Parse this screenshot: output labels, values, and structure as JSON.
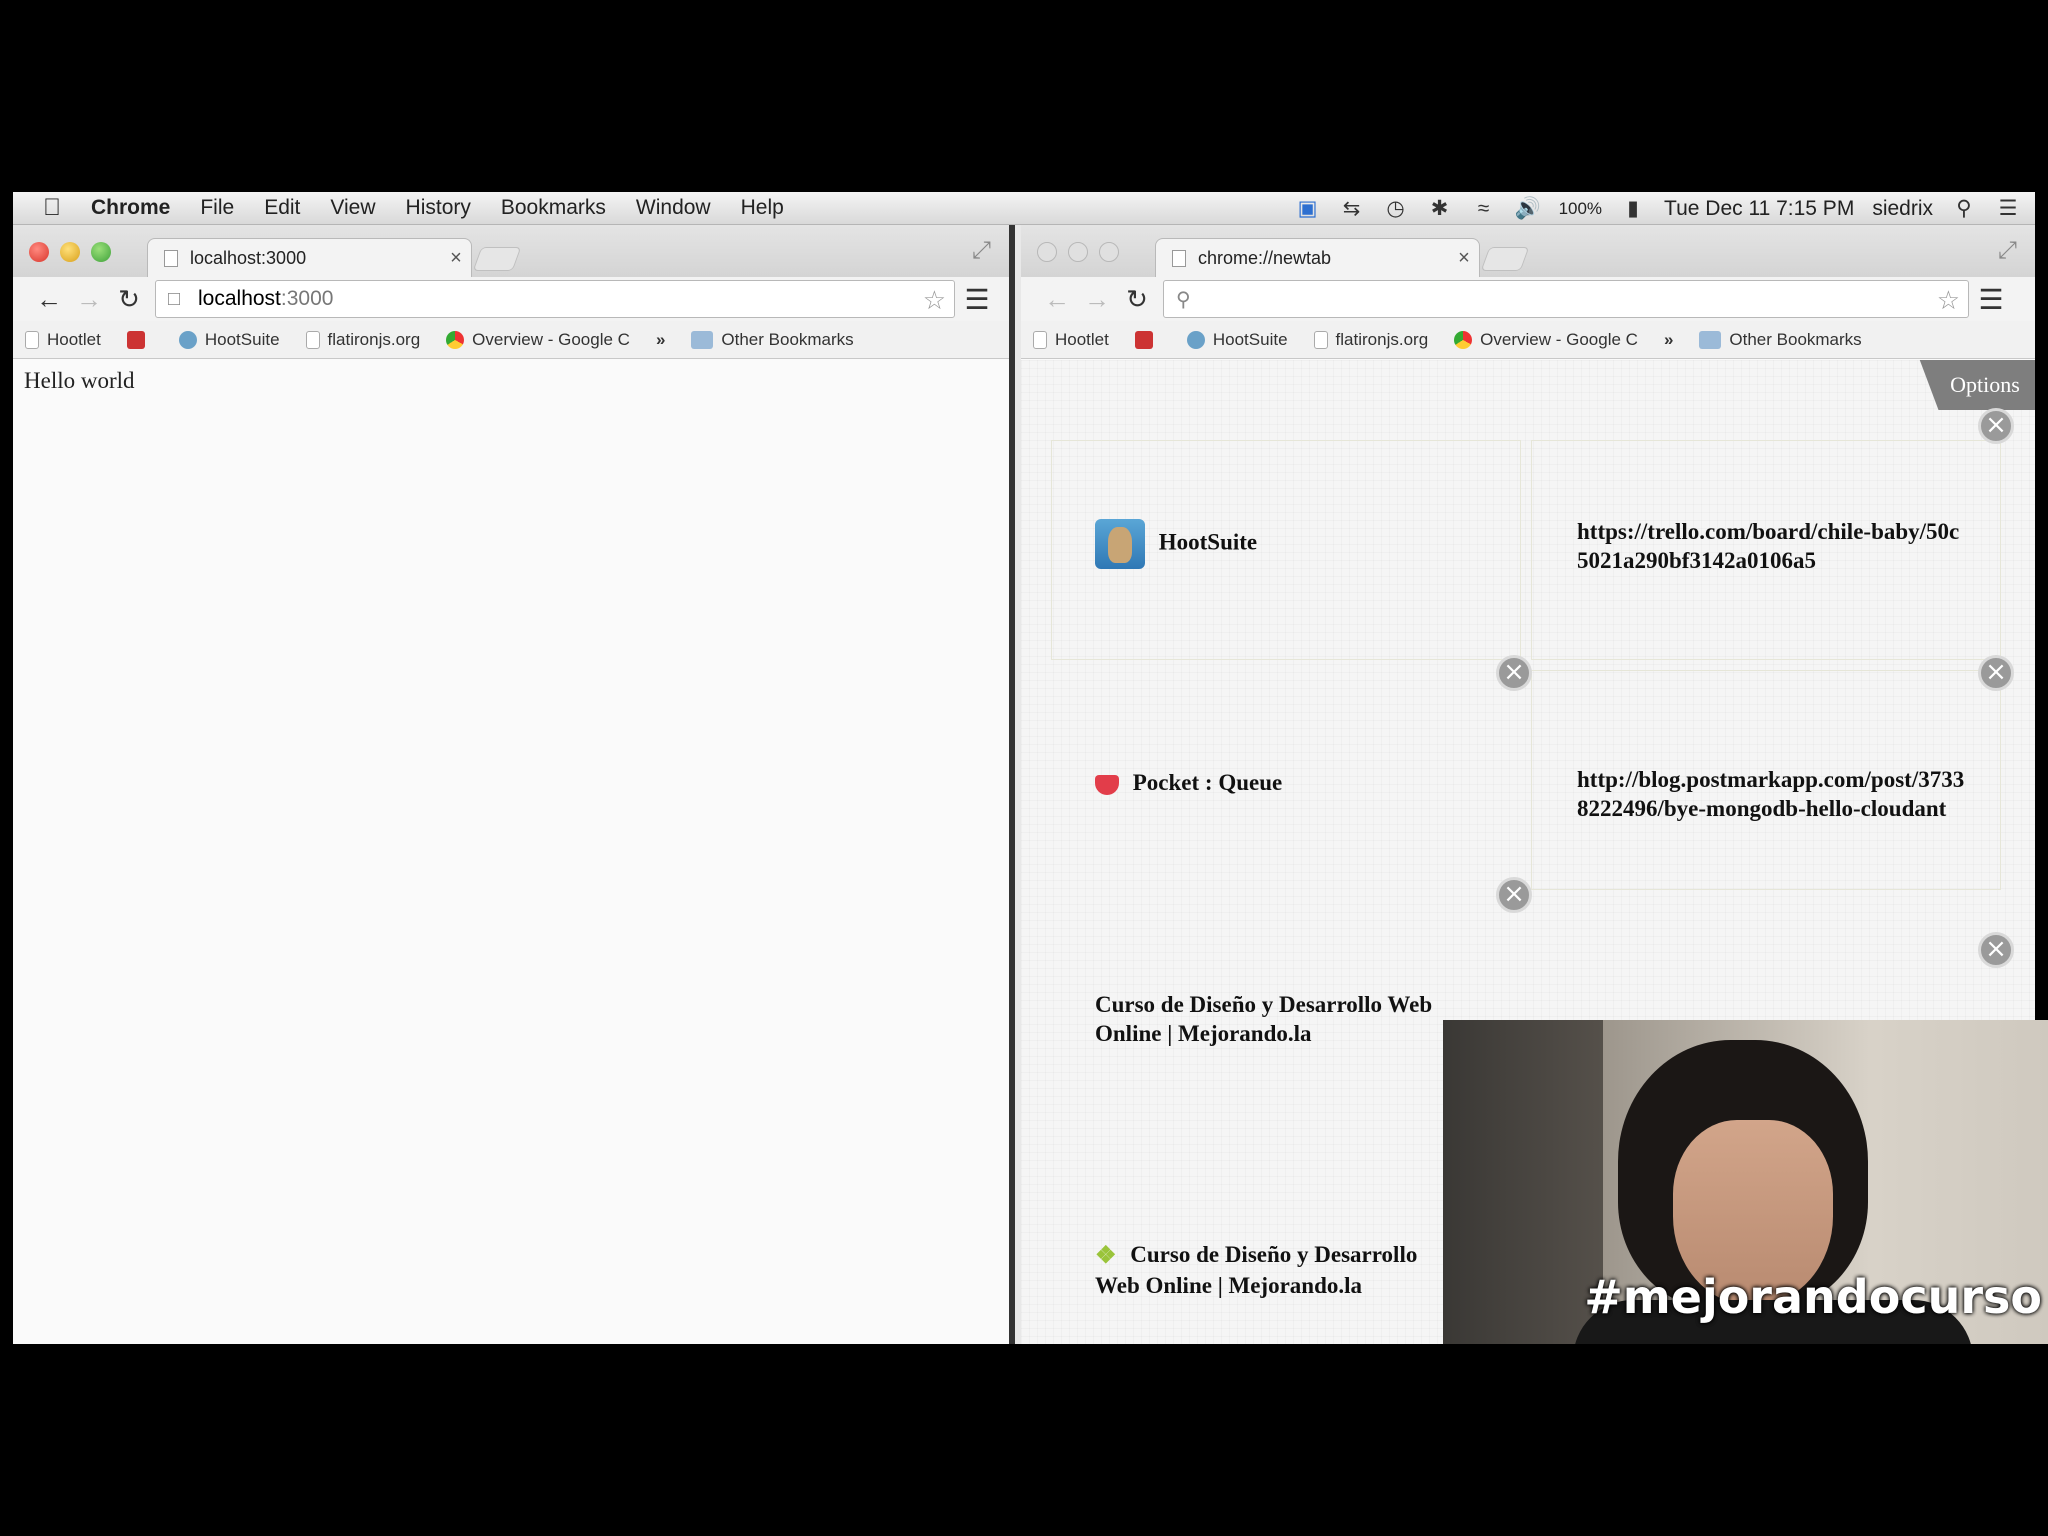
{
  "menubar": {
    "app_name": "Chrome",
    "menus": [
      "File",
      "Edit",
      "View",
      "History",
      "Bookmarks",
      "Window",
      "Help"
    ],
    "battery": "100%",
    "clock": "Tue Dec 11  7:15 PM",
    "user": "siedrix"
  },
  "left_window": {
    "tab_title": "localhost:3000",
    "url_host": "localhost",
    "url_port": ":3000",
    "bookmarks": [
      "Hootlet",
      "HootSuite",
      "flatironjs.org",
      "Overview - Google C"
    ],
    "other_bookmarks": "Other Bookmarks",
    "page_text": "Hello world"
  },
  "right_window": {
    "tab_title": "chrome://newtab",
    "bookmarks": [
      "Hootlet",
      "HootSuite",
      "flatironjs.org",
      "Overview - Google C"
    ],
    "other_bookmarks": "Other Bookmarks",
    "options_label": "Options",
    "tiles": [
      {
        "title": "HootSuite"
      },
      {
        "title": "https://trello.com/board/chile-baby/50c5021a290bf3142a0106a5"
      },
      {
        "title": "Pocket : Queue"
      },
      {
        "title": "http://blog.postmarkapp.com/post/37338222496/bye-mongodb-hello-cloudant"
      },
      {
        "title": "Curso de Diseño y Desarrollo Web Online | Mejorando.la"
      },
      {
        "title": "Curso de Diseño y Desarrollo Web Online | Mejorando.la"
      }
    ]
  },
  "webcam": {
    "hashtag": "#mejorandocurso"
  }
}
